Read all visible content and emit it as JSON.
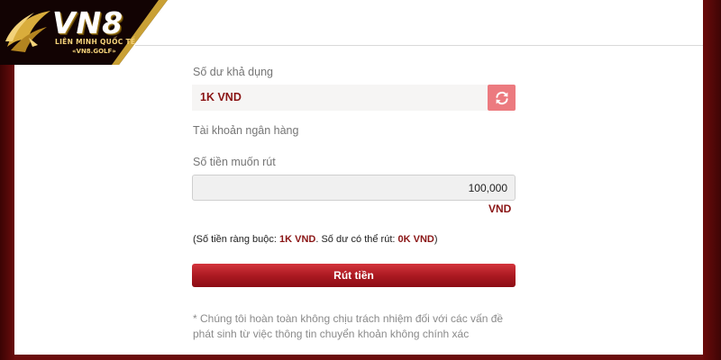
{
  "brand": {
    "logo_text": "VN8",
    "tagline": "LIÊN MINH QUỐC TẾ",
    "url": "«VN8.GOLF»"
  },
  "form": {
    "balance_label": "Số dư khả dụng",
    "balance_value": "1K VND",
    "bank_account_label": "Tài khoản ngân hàng",
    "amount_label": "Số tiền muốn rút",
    "amount_value": "100,000",
    "currency": "VND",
    "constraint": {
      "prefix": "(Số tiền ràng buộc: ",
      "limit": "1K VND",
      "middle": ". Số dư có thể rút: ",
      "withdrawable": "0K VND",
      "suffix": ")"
    },
    "submit_label": "Rút tiền",
    "note": "* Chúng tôi hoàn toàn không chịu trách nhiệm đối với các vấn đề phát sinh từ việc thông tin chuyển khoản không chính xác"
  },
  "icons": {
    "refresh": "refresh-icon",
    "logo_emblem": "feather-emblem-icon"
  },
  "colors": {
    "accent": "#8a1515",
    "button": "#ac1a22",
    "refresh_button": "#ec7a7f",
    "background": "#5e0a0a",
    "logo_gold": "#f4d27a"
  }
}
